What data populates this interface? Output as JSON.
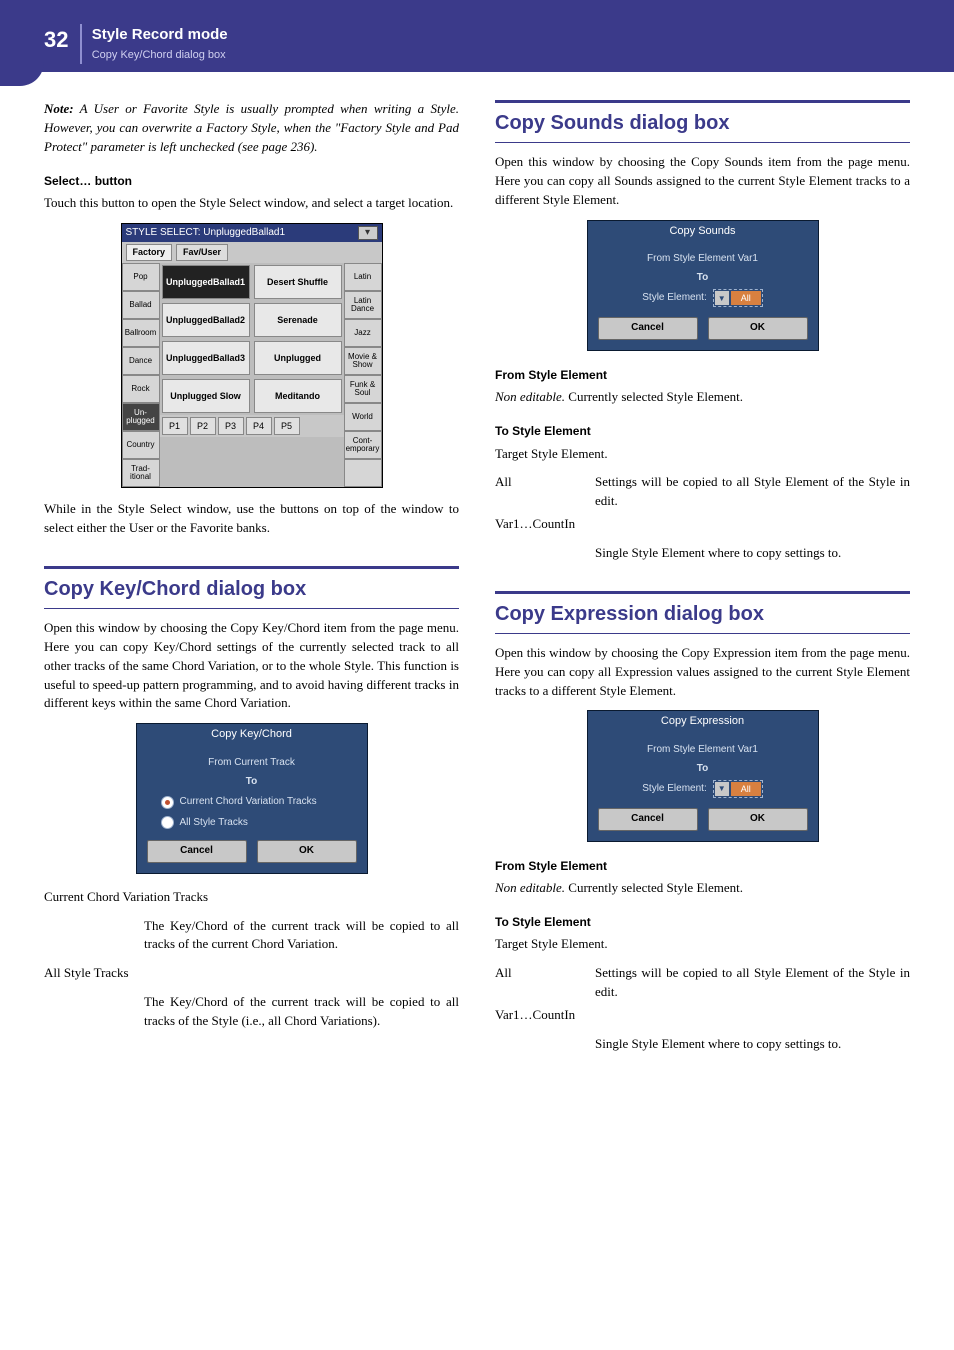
{
  "header": {
    "page_num": "32",
    "title": "Style Record mode",
    "subtitle": "Copy Key/Chord dialog box"
  },
  "left": {
    "note_lead": "Note:",
    "note_body": " A User or Favorite Style is usually prompted when writing a Style. However, you can overwrite a Factory Style, when the \"Factory Style and Pad Protect\" parameter is left unchecked (see page 236).",
    "select_h": "Select… button",
    "select_p": "Touch this button to open the Style Select window, and select a target location.",
    "ss": {
      "title": "STYLE SELECT: UnpluggedBallad1",
      "tabs": [
        "Factory",
        "Fav/User"
      ],
      "left_side": [
        "Pop",
        "Ballad",
        "Ballroom",
        "Dance",
        "Rock",
        "Un-plugged",
        "Country",
        "Trad-itional"
      ],
      "right_side": [
        "Latin",
        "Latin Dance",
        "Jazz",
        "Movie & Show",
        "Funk & Soul",
        "World",
        "Cont-emporary",
        ""
      ],
      "grid": [
        [
          "UnpluggedBallad1",
          "Desert Shuffle"
        ],
        [
          "UnpluggedBallad2",
          "Serenade"
        ],
        [
          "UnpluggedBallad3",
          "Unplugged"
        ],
        [
          "Unplugged Slow",
          "Meditando"
        ]
      ],
      "pages": [
        "P1",
        "P2",
        "P3",
        "P4",
        "P5"
      ]
    },
    "after_ss": "While in the Style Select window, use the buttons on top of the window to select either the User or the Favorite banks.",
    "section_h": "Copy Key/Chord dialog box",
    "section_p": "Open this window by choosing the Copy Key/Chord item from the page menu. Here you can copy Key/Chord settings of the currently selected track to all other tracks of the same Chord Variation, or to the whole Style. This function is useful to speed-up pattern programming, and to avoid having different tracks in different keys within the same Chord Variation.",
    "dlg1": {
      "title": "Copy Key/Chord",
      "from": "From Current Track",
      "to": "To",
      "opt1": "Current Chord Variation Tracks",
      "opt2": "All Style Tracks",
      "cancel": "Cancel",
      "ok": "OK"
    },
    "ccvt_h": "Current Chord Variation Tracks",
    "ccvt_p": "The Key/Chord of the current track will be copied to all tracks of the current Chord Variation.",
    "ast_h": "All Style Tracks",
    "ast_p": "The Key/Chord of the current track will be copied to all tracks of the Style (i.e., all Chord Variations)."
  },
  "right": {
    "s1_h": "Copy Sounds dialog box",
    "s1_p": "Open this window by choosing the Copy Sounds item from the page menu. Here you can copy all Sounds assigned to the current Style Element tracks to a different Style Element.",
    "dlg2": {
      "title": "Copy Sounds",
      "from": "From Style Element Var1",
      "to": "To",
      "label": "Style Element:",
      "value": "All",
      "cancel": "Cancel",
      "ok": "OK"
    },
    "fse_h": "From Style Element",
    "fse_p1": "Non editable.",
    "fse_p2": " Currently selected Style Element.",
    "tse_h": "To Style Element",
    "tse_p": "Target Style Element.",
    "all_t": "All",
    "all_d": "Settings will be copied to all Style Element of the Style in edit.",
    "var_t": "Var1…CountIn",
    "var_d": "Single Style Element where to copy settings to.",
    "s2_h": "Copy Expression dialog box",
    "s2_p": "Open this window by choosing the Copy Expression item from the page menu. Here you can copy all Expression values assigned to the current Style Element tracks to a different Style Element.",
    "dlg3": {
      "title": "Copy Expression",
      "from": "From Style Element Var1",
      "to": "To",
      "label": "Style Element:",
      "value": "All",
      "cancel": "Cancel",
      "ok": "OK"
    }
  }
}
